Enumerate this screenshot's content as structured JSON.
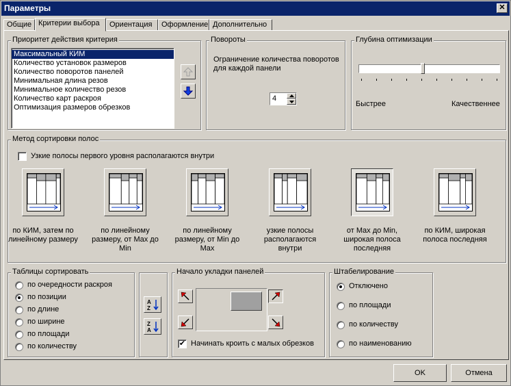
{
  "window": {
    "title": "Параметры",
    "close": "✕"
  },
  "tabs": [
    "Общие",
    "Критерии выбора",
    "Ориентация",
    "Оформление",
    "Дополнительно"
  ],
  "priority": {
    "legend": "Приоритет действия критерия",
    "items": [
      "Максимальный КИМ",
      "Количество установок размеров",
      "Количество поворотов панелей",
      "Минимальная длина резов",
      "Минимальное количество резов",
      "Количество карт раскроя",
      "Оптимизация размеров обрезков"
    ],
    "selected_index": 0
  },
  "rotations": {
    "legend": "Повороты",
    "label": "Ограничение количества поворотов для каждой панели",
    "value": "4"
  },
  "depth": {
    "legend": "Глубина оптимизации",
    "left_label": "Быстрее",
    "right_label": "Качественнее",
    "level_fraction": 0.45
  },
  "sort_method": {
    "legend": "Метод сортировки полос",
    "checkbox_label": "Узкие полосы первого уровня располагаются внутри",
    "checkbox_checked": false,
    "options": [
      "по КИМ, затем по линейному размеру",
      "по линейному размеру, от Max до Min",
      "по линейному размеру, от Min до Max",
      "узкие полосы располагаются внутри",
      "от Max до Min, широкая полоса последняя",
      "по КИМ, широкая полоса последняя"
    ],
    "selected_index": 4
  },
  "tables_sort": {
    "legend": "Таблицы сортировать",
    "options": [
      "по очередности раскроя",
      "по позиции",
      "по длине",
      "по ширине",
      "по площади",
      "по количеству"
    ],
    "selected_index": 1
  },
  "sort_buttons": {
    "asc": "A-Z",
    "desc": "Z-A"
  },
  "start": {
    "legend": "Начало укладки панелей",
    "checkbox_label": "Начинать кроить с малых обрезков",
    "checkbox_checked": true
  },
  "stacking": {
    "legend": "Штабелирование",
    "options": [
      "Отключено",
      "по площади",
      "по количеству",
      "по наименованию"
    ],
    "selected_index": 0
  },
  "buttons": {
    "ok": "OK",
    "cancel": "Отмена"
  }
}
